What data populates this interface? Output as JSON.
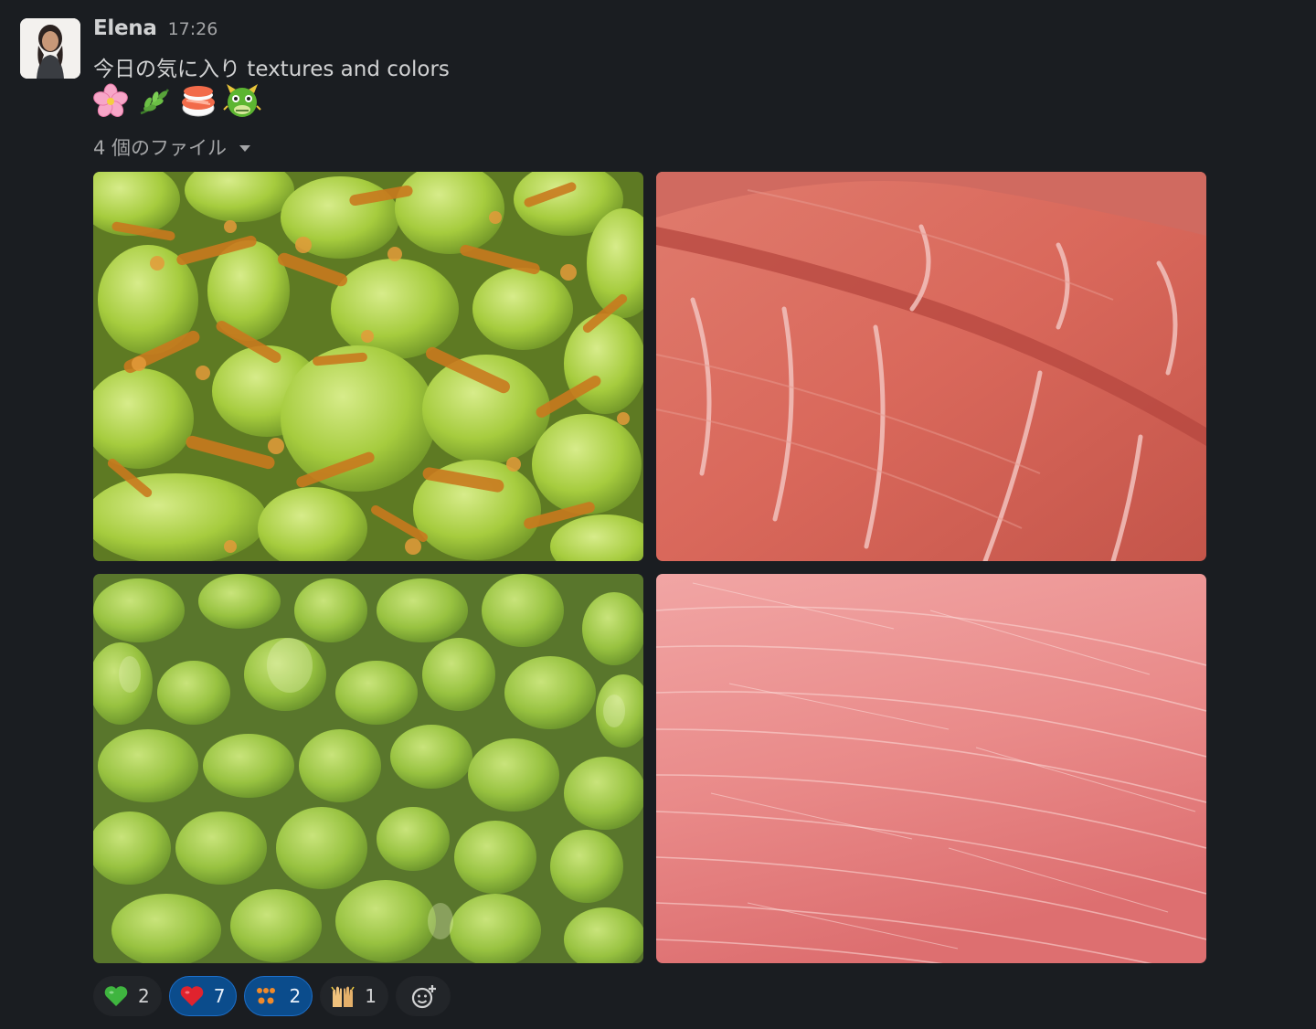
{
  "message": {
    "sender": "Elena",
    "timestamp": "17:26",
    "text": "今日の気に入り textures and colors",
    "emoji_line": [
      "cherry-blossom-icon",
      "herb-icon",
      "sushi-icon",
      "dragon-face-icon"
    ],
    "files_toggle_label": "4 個のファイル"
  },
  "attachments": [
    {
      "icon": "edamame-crumbs-image"
    },
    {
      "icon": "tuna-slices-image"
    },
    {
      "icon": "edamame-beans-image"
    },
    {
      "icon": "tuna-texture-image"
    }
  ],
  "reactions": [
    {
      "emoji": "green-heart-icon",
      "count": "2",
      "active": false
    },
    {
      "emoji": "red-heart-icon",
      "count": "7",
      "active": true
    },
    {
      "emoji": "oishisou-icon",
      "count": "2",
      "active": true
    },
    {
      "emoji": "raised-hands-icon",
      "count": "1",
      "active": false
    }
  ],
  "colors": {
    "background": "#1a1d21",
    "text": "#d1d2d3",
    "muted": "#a4a5a7",
    "reaction_active": "#0b4c8c",
    "reaction_active_border": "#1d6fc9",
    "reaction_bg": "#222529"
  }
}
